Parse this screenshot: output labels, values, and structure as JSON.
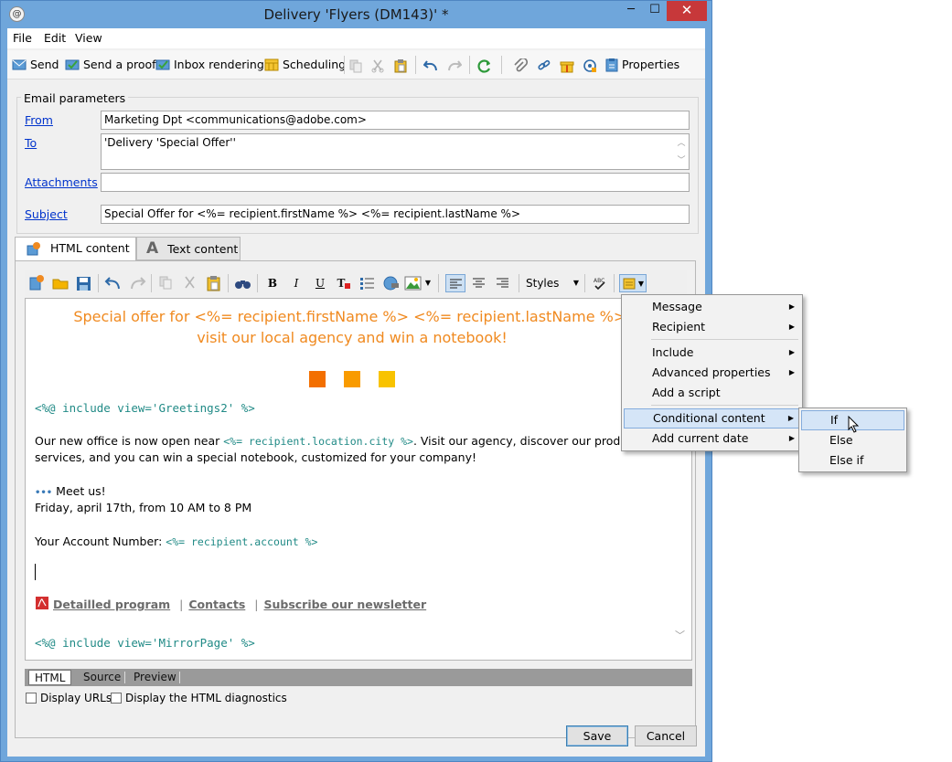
{
  "window": {
    "title": "Delivery 'Flyers (DM143)' *",
    "controls": {
      "minimize": "─",
      "maximize": "☐",
      "close": "✕"
    }
  },
  "menubar": {
    "file": "File",
    "edit": "Edit",
    "view": "View"
  },
  "toolbar": {
    "send": "Send",
    "send_proof": "Send a proof",
    "inbox_rendering": "Inbox rendering",
    "scheduling": "Scheduling",
    "properties": "Properties"
  },
  "email_params": {
    "title": "Email parameters",
    "from_label": "From",
    "from_value": "Marketing Dpt <communications@adobe.com>",
    "to_label": "To",
    "to_value": "'Delivery 'Special Offer''",
    "attachments_label": "Attachments",
    "attachments_value": "",
    "subject_label": "Subject",
    "subject_value": "Special Offer for <%= recipient.firstName %> <%= recipient.lastName %>"
  },
  "tabs": {
    "html": "HTML content",
    "text": "Text content"
  },
  "editor_toolbar": {
    "styles": "Styles"
  },
  "content": {
    "headline_line1": "Special offer for <%= recipient.firstName %> <%= recipient.lastName %>:",
    "headline_line2": "visit our local agency and win a notebook!",
    "include_greetings": "<%@ include view='Greetings2' %>",
    "para1_a": "Our new office is now open near ",
    "para1_code": "<%= recipient.location.city %>",
    "para1_b": ". Visit our agency, discover our products",
    "para1_line2": "services, and you can win a special notebook, customized for your company!",
    "dots": "•••",
    "meet": " Meet us!",
    "date": "Friday, april 17th, from 10 AM to 8 PM",
    "account_label": "Your Account Number: ",
    "account_code": "<%= recipient.account %>",
    "link_program": "Detailled program",
    "link_sep": "|",
    "link_contacts": "Contacts",
    "link_newsletter": "Subscribe our newsletter",
    "include_mirror": "<%@ include view='MirrorPage' %>",
    "square_colors": [
      "#f36f00",
      "#f99b00",
      "#f8c300"
    ]
  },
  "view_tabs": {
    "html": "HTML",
    "source": "Source",
    "preview": "Preview"
  },
  "options": {
    "display_urls": "Display URLs",
    "display_html_diag": "Display the HTML diagnostics"
  },
  "buttons": {
    "save": "Save",
    "cancel": "Cancel"
  },
  "context_menu": {
    "items": {
      "message": "Message",
      "recipient": "Recipient",
      "include": "Include",
      "advanced": "Advanced properties",
      "script": "Add a script",
      "conditional": "Conditional content",
      "date": "Add current date"
    },
    "submenu": {
      "if": "If",
      "else": "Else",
      "else_if": "Else if"
    }
  },
  "colors": {
    "accent_orange": "#f08a20",
    "code_teal": "#208a86",
    "link_blue": "#0033cc",
    "titlebar": "#6fa6db"
  }
}
